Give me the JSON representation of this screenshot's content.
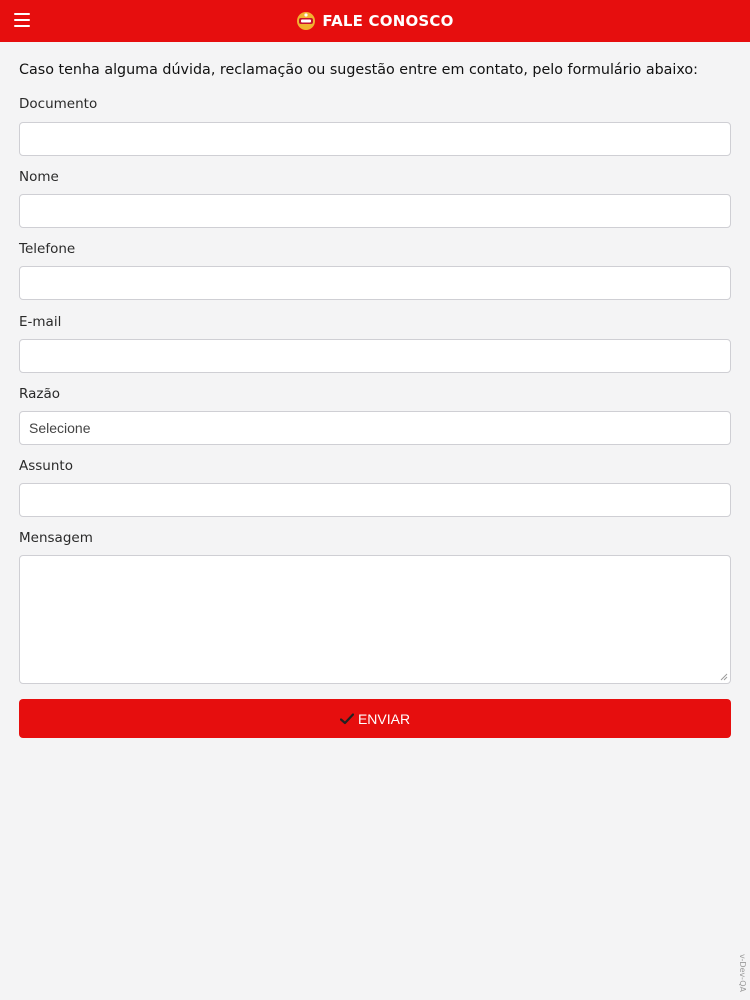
{
  "header": {
    "title": "FALE CONOSCO",
    "menu_icon": "hamburger-menu-icon",
    "logo_icon": "brand-logo-icon",
    "background_color": "#e60e0e"
  },
  "form": {
    "intro": "Caso tenha alguma dúvida, reclamação ou sugestão entre em contato, pelo formulário abaixo:",
    "fields": {
      "documento": {
        "label": "Documento",
        "value": ""
      },
      "nome": {
        "label": "Nome",
        "value": ""
      },
      "telefone": {
        "label": "Telefone",
        "value": ""
      },
      "email": {
        "label": "E-mail",
        "value": ""
      },
      "razao": {
        "label": "Razão",
        "selected": "Selecione"
      },
      "assunto": {
        "label": "Assunto",
        "value": ""
      },
      "mensagem": {
        "label": "Mensagem",
        "value": ""
      }
    },
    "submit": {
      "label": "ENVIAR",
      "icon": "check-icon",
      "color": "#e60e0e"
    }
  },
  "footer": {
    "version": "v-Dev-QA"
  }
}
